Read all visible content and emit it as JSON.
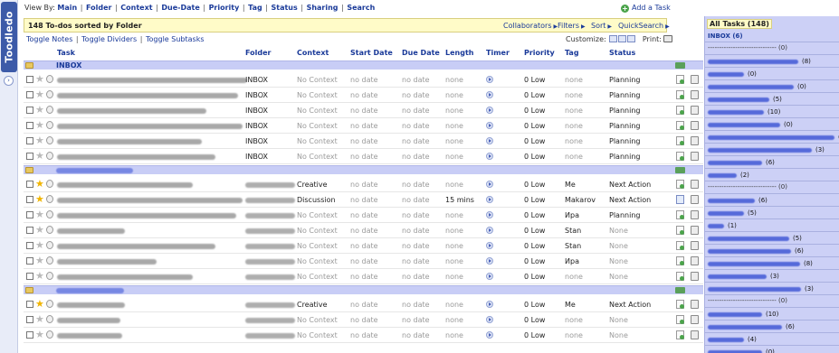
{
  "logo": {
    "text": "Toodledo"
  },
  "topbar": {
    "viewby_label": "View By:",
    "views": [
      "Main",
      "Folder",
      "Context",
      "Due-Date",
      "Priority",
      "Tag",
      "Status",
      "Sharing",
      "Search"
    ],
    "add_task": "Add a Task"
  },
  "header": {
    "title": "148 To-dos sorted by Folder",
    "collaborators": "Collaborators",
    "filters": "Filters",
    "sort": "Sort",
    "quicksearch": "QuickSearch",
    "toggle_notes": "Toggle Notes",
    "toggle_dividers": "Toggle Dividers",
    "toggle_subtasks": "Toggle Subtasks",
    "customize": "Customize:",
    "print": "Print:"
  },
  "columns": {
    "task": "Task",
    "folder": "Folder",
    "context": "Context",
    "start": "Start Date",
    "due": "Due Date",
    "length": "Length",
    "timer": "Timer",
    "priority": "Priority",
    "tag": "Tag",
    "status": "Status"
  },
  "groups": [
    {
      "name": "INBOX",
      "rows": [
        {
          "star": false,
          "folder": "INBOX",
          "context": "No Context",
          "context_muted": true,
          "start": "no date",
          "due": "no date",
          "length": "none",
          "length_muted": true,
          "priority": "0 Low",
          "tag": "none",
          "tag_muted": true,
          "status": "Planning",
          "status_muted": false
        },
        {
          "star": false,
          "folder": "INBOX",
          "context": "No Context",
          "context_muted": true,
          "start": "no date",
          "due": "no date",
          "length": "none",
          "length_muted": true,
          "priority": "0 Low",
          "tag": "none",
          "tag_muted": true,
          "status": "Planning",
          "status_muted": false
        },
        {
          "star": false,
          "folder": "INBOX",
          "context": "No Context",
          "context_muted": true,
          "start": "no date",
          "due": "no date",
          "length": "none",
          "length_muted": true,
          "priority": "0 Low",
          "tag": "none",
          "tag_muted": true,
          "status": "Planning",
          "status_muted": false
        },
        {
          "star": false,
          "folder": "INBOX",
          "context": "No Context",
          "context_muted": true,
          "start": "no date",
          "due": "no date",
          "length": "none",
          "length_muted": true,
          "priority": "0 Low",
          "tag": "none",
          "tag_muted": true,
          "status": "Planning",
          "status_muted": false
        },
        {
          "star": false,
          "folder": "INBOX",
          "context": "No Context",
          "context_muted": true,
          "start": "no date",
          "due": "no date",
          "length": "none",
          "length_muted": true,
          "priority": "0 Low",
          "tag": "none",
          "tag_muted": true,
          "status": "Planning",
          "status_muted": false
        },
        {
          "star": false,
          "folder": "INBOX",
          "context": "No Context",
          "context_muted": true,
          "start": "no date",
          "due": "no date",
          "length": "none",
          "length_muted": true,
          "priority": "0 Low",
          "tag": "none",
          "tag_muted": true,
          "status": "Planning",
          "status_muted": false
        }
      ]
    },
    {
      "name": "",
      "rows": [
        {
          "star": true,
          "folder": "",
          "context": "Creative",
          "context_muted": false,
          "start": "no date",
          "due": "no date",
          "length": "none",
          "length_muted": true,
          "priority": "0 Low",
          "tag": "Me",
          "tag_muted": false,
          "status": "Next Action",
          "status_muted": false
        },
        {
          "star": true,
          "folder": "",
          "context": "Discussion",
          "context_muted": false,
          "start": "no date",
          "due": "no date",
          "length": "15 mins",
          "length_muted": false,
          "priority": "0 Low",
          "tag": "Makarov",
          "tag_muted": false,
          "status": "Next Action",
          "status_muted": false
        },
        {
          "star": false,
          "folder": "",
          "context": "No Context",
          "context_muted": true,
          "start": "no date",
          "due": "no date",
          "length": "none",
          "length_muted": true,
          "priority": "0 Low",
          "tag": "Ира",
          "tag_muted": false,
          "status": "Planning",
          "status_muted": false
        },
        {
          "star": false,
          "folder": "",
          "context": "No Context",
          "context_muted": true,
          "start": "no date",
          "due": "no date",
          "length": "none",
          "length_muted": true,
          "priority": "0 Low",
          "tag": "Stan",
          "tag_muted": false,
          "status": "None",
          "status_muted": true
        },
        {
          "star": false,
          "folder": "",
          "context": "No Context",
          "context_muted": true,
          "start": "no date",
          "due": "no date",
          "length": "none",
          "length_muted": true,
          "priority": "0 Low",
          "tag": "Stan",
          "tag_muted": false,
          "status": "None",
          "status_muted": true
        },
        {
          "star": false,
          "folder": "",
          "context": "No Context",
          "context_muted": true,
          "start": "no date",
          "due": "no date",
          "length": "none",
          "length_muted": true,
          "priority": "0 Low",
          "tag": "Ира",
          "tag_muted": false,
          "status": "None",
          "status_muted": true
        },
        {
          "star": false,
          "folder": "",
          "context": "No Context",
          "context_muted": true,
          "start": "no date",
          "due": "no date",
          "length": "none",
          "length_muted": true,
          "priority": "0 Low",
          "tag": "none",
          "tag_muted": true,
          "status": "None",
          "status_muted": true
        }
      ]
    },
    {
      "name": "",
      "rows": [
        {
          "star": true,
          "folder": "",
          "context": "Creative",
          "context_muted": false,
          "start": "no date",
          "due": "no date",
          "length": "none",
          "length_muted": true,
          "priority": "0 Low",
          "tag": "Me",
          "tag_muted": false,
          "status": "Next Action",
          "status_muted": false
        },
        {
          "star": false,
          "folder": "",
          "context": "No Context",
          "context_muted": true,
          "start": "no date",
          "due": "no date",
          "length": "none",
          "length_muted": true,
          "priority": "0 Low",
          "tag": "none",
          "tag_muted": true,
          "status": "None",
          "status_muted": true
        },
        {
          "star": false,
          "folder": "",
          "context": "No Context",
          "context_muted": true,
          "start": "no date",
          "due": "no date",
          "length": "none",
          "length_muted": true,
          "priority": "0 Low",
          "tag": "none",
          "tag_muted": true,
          "status": "None",
          "status_muted": true
        }
      ]
    }
  ],
  "sidebar": {
    "all_tasks": "All Tasks (148)",
    "inbox": "INBOX (6)",
    "items": [
      {
        "kind": "divider",
        "count": "(0)"
      },
      {
        "kind": "folder",
        "count": "(8)"
      },
      {
        "kind": "folder",
        "count": "(0)"
      },
      {
        "kind": "folder",
        "count": "(0)"
      },
      {
        "kind": "folder",
        "count": "(5)"
      },
      {
        "kind": "folder",
        "count": "(10)"
      },
      {
        "kind": "folder",
        "count": "(0)"
      },
      {
        "kind": "folder",
        "count": "(0)"
      },
      {
        "kind": "folder",
        "count": "(3)"
      },
      {
        "kind": "folder",
        "count": "(6)"
      },
      {
        "kind": "folder",
        "count": "(2)"
      },
      {
        "kind": "divider",
        "count": "(0)"
      },
      {
        "kind": "folder",
        "count": "(6)"
      },
      {
        "kind": "folder",
        "count": "(5)"
      },
      {
        "kind": "folder",
        "count": "(1)"
      },
      {
        "kind": "folder",
        "count": "(5)"
      },
      {
        "kind": "folder",
        "count": "(6)"
      },
      {
        "kind": "folder",
        "count": "(8)"
      },
      {
        "kind": "folder",
        "count": "(3)"
      },
      {
        "kind": "folder",
        "count": "(3)"
      },
      {
        "kind": "divider",
        "count": "(0)"
      },
      {
        "kind": "folder",
        "count": "(10)"
      },
      {
        "kind": "folder",
        "count": "(6)"
      },
      {
        "kind": "folder",
        "count": "(4)"
      },
      {
        "kind": "folder",
        "count": "(0)"
      }
    ]
  }
}
